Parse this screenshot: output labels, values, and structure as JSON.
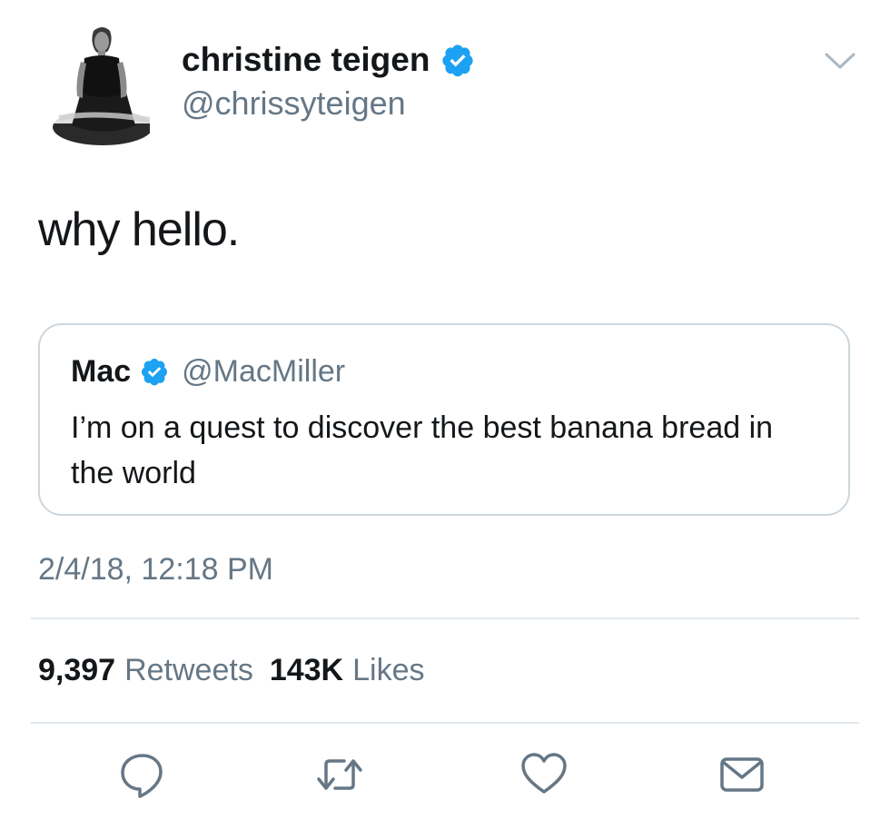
{
  "author": {
    "display_name": "christine teigen",
    "handle": "@chrissyteigen",
    "verified": true
  },
  "tweet": {
    "text": "why hello."
  },
  "quoted_tweet": {
    "display_name": "Mac",
    "handle": "@MacMiller",
    "verified": true,
    "text": "I’m on a quest to discover the best banana bread in the world"
  },
  "timestamp": "2/4/18, 12:18 PM",
  "stats": {
    "retweets_count": "9,397",
    "retweets_label": "Retweets",
    "likes_count": "143K",
    "likes_label": "Likes"
  },
  "actions": {
    "reply_icon": "reply-icon",
    "retweet_icon": "retweet-icon",
    "like_icon": "heart-icon",
    "dm_icon": "envelope-icon"
  },
  "colors": {
    "verified_blue": "#1da1f2",
    "secondary_text": "#657786",
    "border": "#ccd6dd"
  }
}
